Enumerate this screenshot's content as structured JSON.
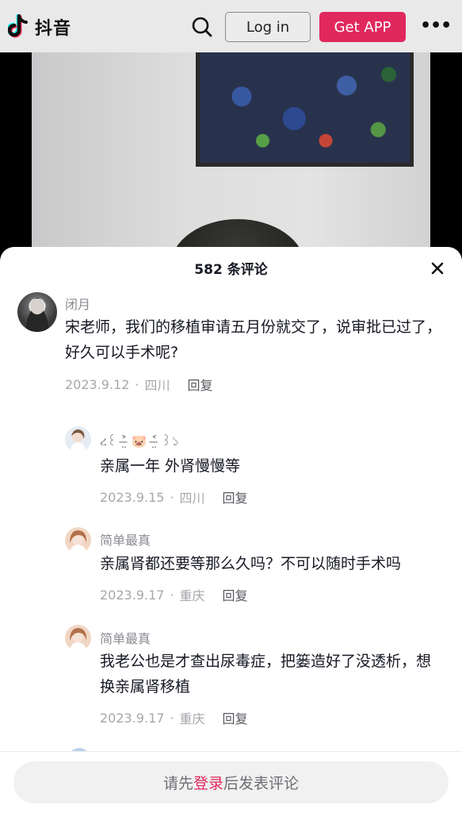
{
  "header": {
    "logo_icon": "douyin-note-icon",
    "logo_text": "抖音",
    "search_icon": "search-icon",
    "login_label": "Log in",
    "getapp_label": "Get APP",
    "more_icon": "more-dots-icon",
    "more_glyph": "•••"
  },
  "comments_panel": {
    "title": "582 条评论",
    "close_icon": "close-icon",
    "comments": [
      {
        "username": "闭月",
        "text": "宋老师，我们的移植审请五月份就交了，说审批已过了，好久可以手术呢?",
        "date": "2023.9.12",
        "location": "四川",
        "reply_label": "回复"
      },
      {
        "username": "ረ꒰ ˃̶̤̀ 🐷 ˂̶̤́ ꒱১",
        "text": "亲属一年 外肾慢慢等",
        "date": "2023.9.15",
        "location": "四川",
        "reply_label": "回复"
      },
      {
        "username": "简单最真",
        "text": "亲属肾都还要等那么久吗？不可以随时手术吗",
        "date": "2023.9.17",
        "location": "重庆",
        "reply_label": "回复"
      },
      {
        "username": "简单最真",
        "text": "我老公也是才查出尿毒症，把篓造好了没透析，想换亲属肾移植",
        "date": "2023.9.17",
        "location": "重庆",
        "reply_label": "回复"
      }
    ]
  },
  "bottom_bar": {
    "prefix": "请先",
    "login_link": "登录",
    "suffix": "后发表评论"
  },
  "colors": {
    "accent": "#e0285c",
    "text_primary": "#161823",
    "text_secondary": "#8a8b91"
  }
}
